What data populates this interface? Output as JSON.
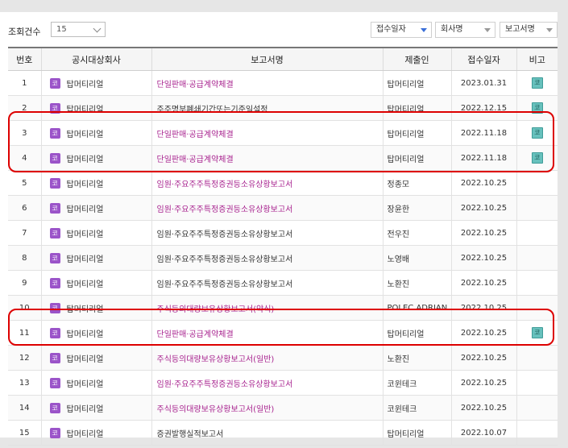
{
  "toolbar": {
    "count_label": "조회건수",
    "page_size": "15",
    "sort_date": "접수일자",
    "sort_company": "회사명",
    "sort_report": "보고서명"
  },
  "columns": [
    "번호",
    "공시대상회사",
    "보고서명",
    "제출인",
    "접수일자",
    "비고"
  ],
  "badge_text": "코",
  "note_icon_text": "코",
  "colors": {
    "link": "#a8238f",
    "badge": "#9b54c9",
    "highlight": "#dd0000",
    "note": "#67c1bd"
  },
  "rows": [
    {
      "no": "1",
      "company": "탑머티리얼",
      "report": "단일판매·공급계약체결",
      "link": true,
      "submitter": "탑머티리얼",
      "date": "2023.01.31",
      "note": true
    },
    {
      "no": "2",
      "company": "탑머티리얼",
      "report": "주주명부폐쇄기간또는기준일설정",
      "link": false,
      "submitter": "탑머티리얼",
      "date": "2022.12.15",
      "note": true
    },
    {
      "no": "3",
      "company": "탑머티리얼",
      "report": "단일판매·공급계약체결",
      "link": true,
      "submitter": "탑머티리얼",
      "date": "2022.11.18",
      "note": true
    },
    {
      "no": "4",
      "company": "탑머티리얼",
      "report": "단일판매·공급계약체결",
      "link": true,
      "submitter": "탑머티리얼",
      "date": "2022.11.18",
      "note": true
    },
    {
      "no": "5",
      "company": "탑머티리얼",
      "report": "임원·주요주주특정증권등소유상황보고서",
      "link": true,
      "submitter": "정종모",
      "date": "2022.10.25",
      "note": false
    },
    {
      "no": "6",
      "company": "탑머티리얼",
      "report": "임원·주요주주특정증권등소유상황보고서",
      "link": true,
      "submitter": "장윤한",
      "date": "2022.10.25",
      "note": false
    },
    {
      "no": "7",
      "company": "탑머티리얼",
      "report": "임원·주요주주특정증권등소유상황보고서",
      "link": false,
      "submitter": "전우진",
      "date": "2022.10.25",
      "note": false
    },
    {
      "no": "8",
      "company": "탑머티리얼",
      "report": "임원·주요주주특정증권등소유상황보고서",
      "link": false,
      "submitter": "노영배",
      "date": "2022.10.25",
      "note": false
    },
    {
      "no": "9",
      "company": "탑머티리얼",
      "report": "임원·주요주주특정증권등소유상황보고서",
      "link": false,
      "submitter": "노환진",
      "date": "2022.10.25",
      "note": false
    },
    {
      "no": "10",
      "company": "탑머티리얼",
      "report": "주식등의대량보유상황보고서(약식)",
      "link": true,
      "submitter": "POLEC ADRIAN...",
      "date": "2022.10.25",
      "note": false
    },
    {
      "no": "11",
      "company": "탑머티리얼",
      "report": "단일판매·공급계약체결",
      "link": true,
      "submitter": "탑머티리얼",
      "date": "2022.10.25",
      "note": true
    },
    {
      "no": "12",
      "company": "탑머티리얼",
      "report": "주식등의대량보유상황보고서(일반)",
      "link": true,
      "submitter": "노환진",
      "date": "2022.10.25",
      "note": false
    },
    {
      "no": "13",
      "company": "탑머티리얼",
      "report": "임원·주요주주특정증권등소유상황보고서",
      "link": true,
      "submitter": "코윈테크",
      "date": "2022.10.25",
      "note": false
    },
    {
      "no": "14",
      "company": "탑머티리얼",
      "report": "주식등의대량보유상황보고서(일반)",
      "link": true,
      "submitter": "코윈테크",
      "date": "2022.10.25",
      "note": false
    },
    {
      "no": "15",
      "company": "탑머티리얼",
      "report": "증권발행실적보고서",
      "link": false,
      "submitter": "탑머티리얼",
      "date": "2022.10.07",
      "note": false
    }
  ]
}
